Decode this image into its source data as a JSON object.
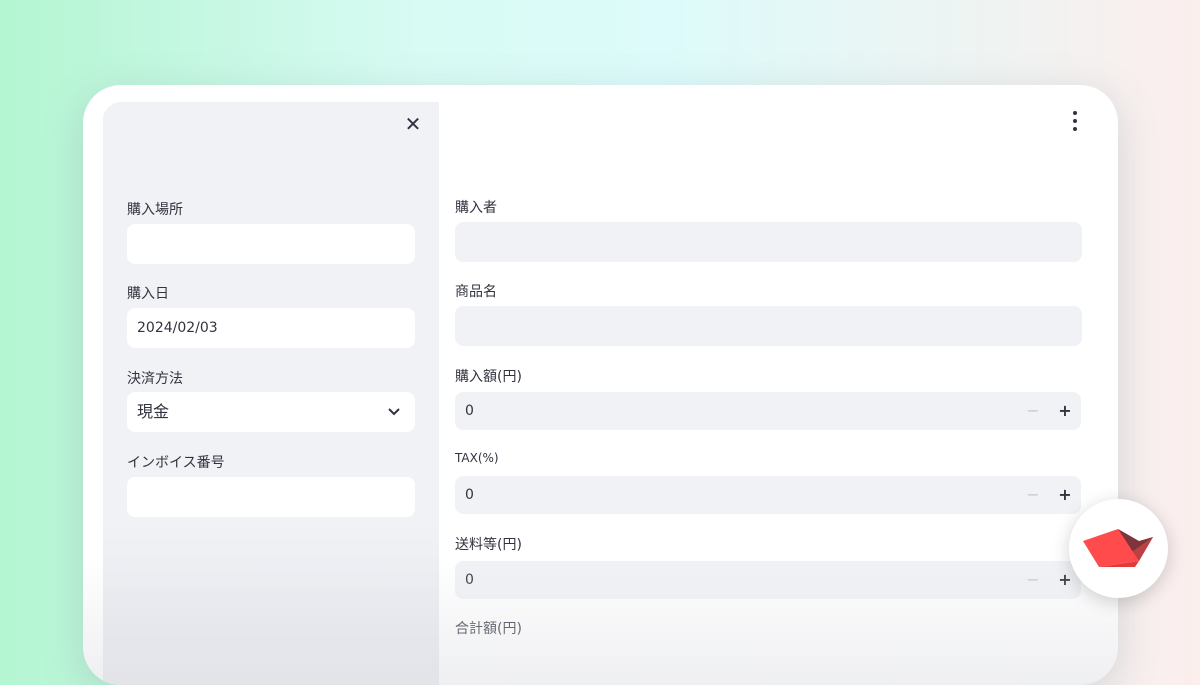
{
  "sidebar": {
    "fields": [
      {
        "label": "購入場所",
        "value": ""
      },
      {
        "label": "購入日",
        "value": "2024/02/03"
      },
      {
        "label": "決済方法",
        "value": "現金"
      },
      {
        "label": "インボイス番号",
        "value": ""
      }
    ]
  },
  "main": {
    "buyer": {
      "label": "購入者",
      "value": ""
    },
    "product": {
      "label": "商品名",
      "value": ""
    },
    "amount": {
      "label": "購入額(円)",
      "value": "0"
    },
    "tax": {
      "label": "TAX(%)",
      "value": "0"
    },
    "shipping": {
      "label": "送料等(円)",
      "value": "0"
    },
    "total": {
      "label": "合計額(円)"
    }
  },
  "icons": {
    "close": "close-icon",
    "menu": "kebab-menu-icon",
    "chevron": "chevron-down-icon",
    "minus": "minus-icon",
    "plus": "plus-icon",
    "logo": "streamlit-logo"
  },
  "colors": {
    "accent": "#ff4b4b",
    "panel": "#f0f2f6",
    "text": "#31333f"
  }
}
